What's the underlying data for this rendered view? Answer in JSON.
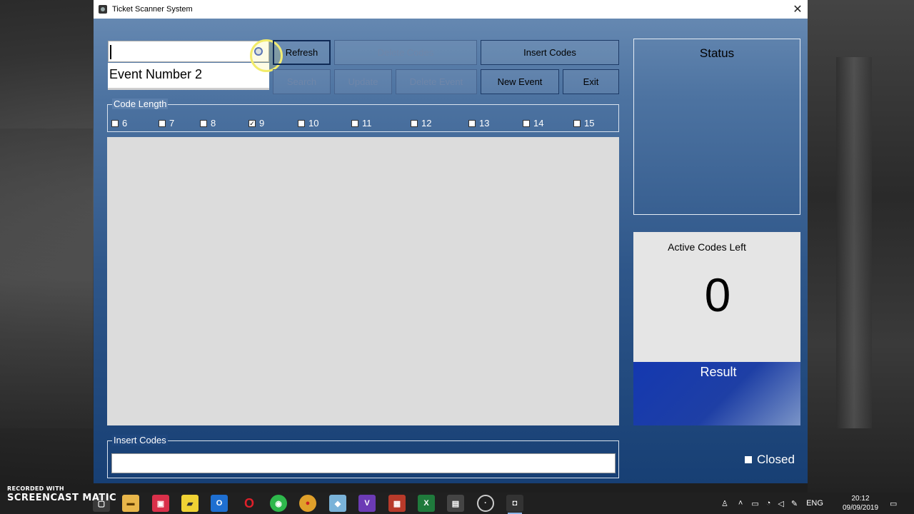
{
  "window": {
    "title": "Ticket Scanner System",
    "close_glyph": "✕"
  },
  "event_select": {
    "current_value": "",
    "options": [
      "Event Number 2"
    ]
  },
  "buttons": {
    "refresh": "Refresh",
    "delete_codes": "Delete Codes",
    "insert_codes": "Insert Codes",
    "search": "Search",
    "update": "Update",
    "delete_event": "Delete Event",
    "new_event": "New Event",
    "exit": "Exit"
  },
  "code_length": {
    "legend": "Code Length",
    "options": [
      {
        "label": "6",
        "checked": false
      },
      {
        "label": "7",
        "checked": false
      },
      {
        "label": "8",
        "checked": false
      },
      {
        "label": "9",
        "checked": true
      },
      {
        "label": "10",
        "checked": false
      },
      {
        "label": "11",
        "checked": false
      },
      {
        "label": "12",
        "checked": false
      },
      {
        "label": "13",
        "checked": false
      },
      {
        "label": "14",
        "checked": false
      },
      {
        "label": "15",
        "checked": false
      }
    ]
  },
  "insert_codes": {
    "legend": "Insert Codes",
    "value": ""
  },
  "status": {
    "title": "Status"
  },
  "active_codes": {
    "label": "Active Codes Left",
    "count": "0"
  },
  "result": {
    "label": "Result"
  },
  "indicator": {
    "label": "Closed"
  },
  "watermark": {
    "line1": "RECORDED WITH",
    "line2": "SCREENCAST",
    "line3": "MATIC"
  },
  "taskbar": {
    "tray_language": "ENG",
    "clock_time": "20:12",
    "clock_date": "09/09/2019"
  },
  "colors": {
    "window_gradient_top": "#6b8db5",
    "window_gradient_bottom": "#173f74",
    "result_blue": "#1438b0",
    "listbox_gray": "#dcdcdc"
  }
}
